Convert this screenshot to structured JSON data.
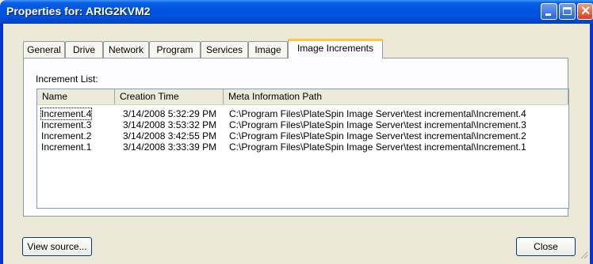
{
  "window": {
    "title": "Properties for: ARIG2KVM2"
  },
  "tabs": [
    {
      "label": "General"
    },
    {
      "label": "Drive"
    },
    {
      "label": "Network"
    },
    {
      "label": "Program"
    },
    {
      "label": "Services"
    },
    {
      "label": "Image"
    },
    {
      "label": "Image Increments",
      "active": true
    }
  ],
  "increments": {
    "label": "Increment List:",
    "columns": [
      "Name",
      "Creation Time",
      "Meta Information Path"
    ],
    "rows": [
      {
        "name": "Increment.4",
        "time": "3/14/2008 5:32:29 PM",
        "path": "C:\\Program Files\\PlateSpin Image Server\\test incremental\\Increment.4"
      },
      {
        "name": "Increment.3",
        "time": "3/14/2008 3:53:32 PM",
        "path": "C:\\Program Files\\PlateSpin Image Server\\test incremental\\Increment.3"
      },
      {
        "name": "Increment.2",
        "time": "3/14/2008 3:42:55 PM",
        "path": "C:\\Program Files\\PlateSpin Image Server\\test incremental\\Increment.2"
      },
      {
        "name": "Increment.1",
        "time": "3/14/2008 3:33:39 PM",
        "path": "C:\\Program Files\\PlateSpin Image Server\\test incremental\\Increment.1"
      }
    ]
  },
  "buttons": {
    "view_source": "View source...",
    "close": "Close"
  }
}
